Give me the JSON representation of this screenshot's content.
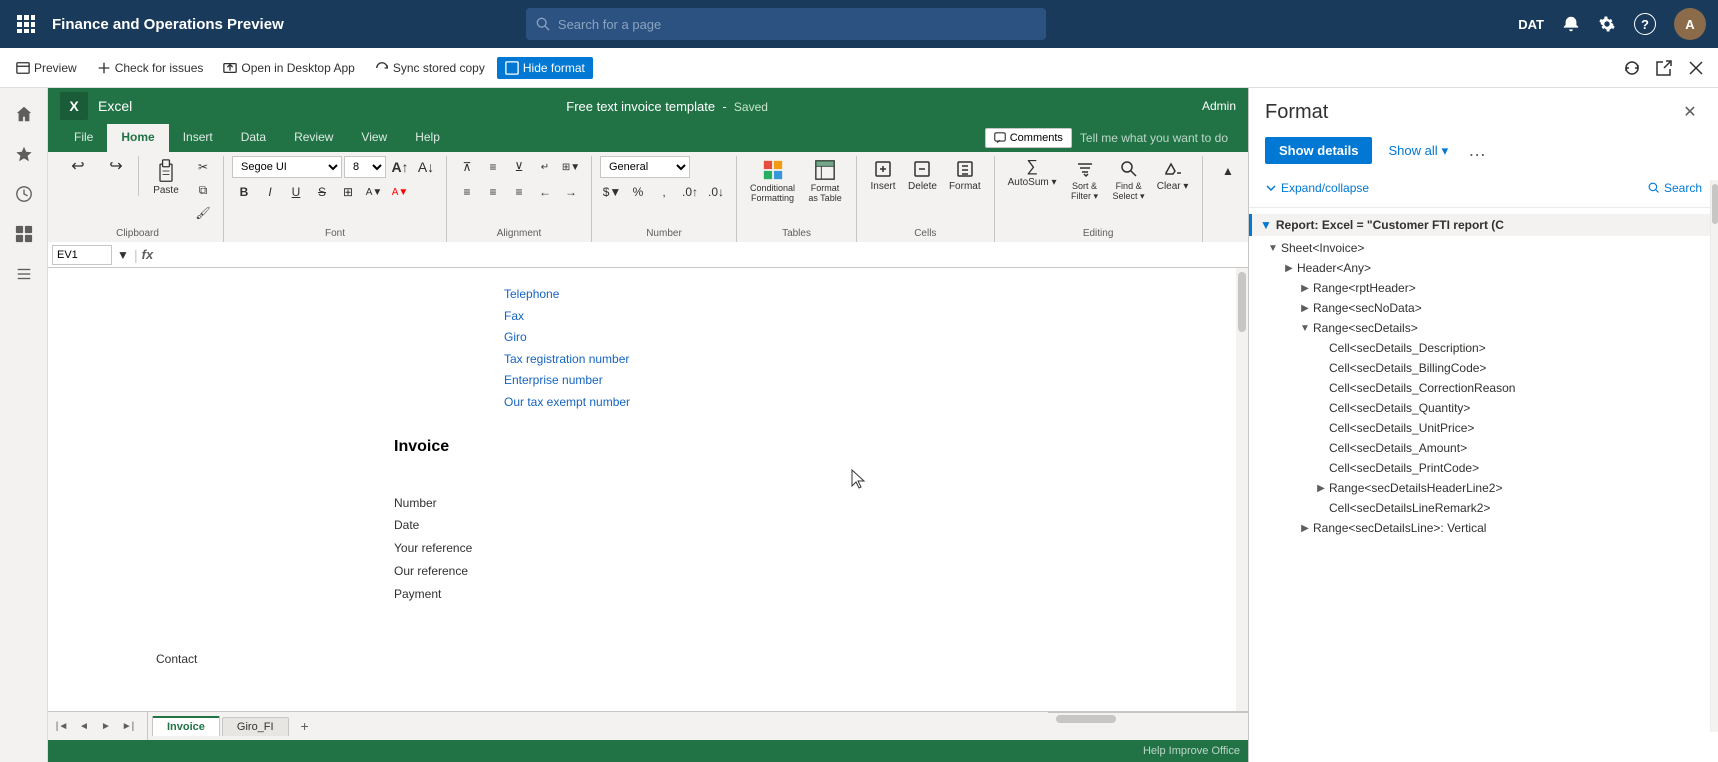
{
  "topnav": {
    "waffle_icon": "⊞",
    "title": "Finance and Operations Preview",
    "search_placeholder": "Search for a page",
    "env": "DAT",
    "bell_icon": "🔔",
    "gear_icon": "⚙",
    "help_icon": "?",
    "avatar_initials": "A"
  },
  "toolbar": {
    "preview_label": "Preview",
    "check_issues_label": "Check for issues",
    "open_desktop_label": "Open in Desktop App",
    "sync_label": "Sync stored copy",
    "hide_format_label": "Hide format"
  },
  "excel": {
    "logo_letter": "X",
    "app_name": "Excel",
    "file_title": "Free text invoice template",
    "separator": "-",
    "saved_status": "Saved",
    "admin_label": "Admin"
  },
  "ribbon": {
    "tabs": [
      "File",
      "Home",
      "Insert",
      "Data",
      "Review",
      "View",
      "Help"
    ],
    "active_tab": "Home",
    "tell_me": "Tell me what you want to do",
    "comments_label": "Comments",
    "groups": {
      "undo": {
        "label": "Undo",
        "redo": "Redo"
      },
      "paste_label": "Clipboard",
      "font_label": "Font",
      "alignment_label": "Alignment",
      "number_label": "Number",
      "tables_label": "Tables",
      "cells_label": "Cells",
      "editing_label": "Editing"
    },
    "font_name": "Segoe UI",
    "font_size": "8",
    "number_format": "General",
    "format_as_table": "Format as Table",
    "conditional": "Conditional Formatting",
    "format": "Format",
    "insert": "Insert",
    "delete": "Delete",
    "autosum": "AutoSum",
    "sort_filter": "Sort & Filter",
    "find_select": "Find & Select",
    "clear": "Clear ~"
  },
  "formula_bar": {
    "cell_ref": "EV1",
    "fx_label": "fx"
  },
  "spreadsheet": {
    "fields": [
      "Telephone",
      "Fax",
      "Giro",
      "Tax registration number",
      "Enterprise number",
      "Our tax exempt number"
    ],
    "invoice_title": "Invoice",
    "invoice_fields": [
      "Number",
      "Date",
      "Your reference",
      "Our reference",
      "Payment"
    ],
    "contact_label": "Contact"
  },
  "sheet_tabs": {
    "tabs": [
      "Invoice",
      "Giro_FI"
    ],
    "active": "Invoice"
  },
  "status_bar": {
    "help": "Help Improve Office"
  },
  "right_panel": {
    "title": "Format",
    "show_details_label": "Show details",
    "show_all_label": "Show all",
    "expand_label": "Expand/collapse",
    "search_label": "Search",
    "close_icon": "✕",
    "more_icon": "…",
    "root_item": "Report: Excel = \"Customer FTI report (C",
    "tree": [
      {
        "label": "Sheet<Invoice>",
        "indent": 1,
        "expanded": true,
        "toggle": "▼"
      },
      {
        "label": "Header<Any>",
        "indent": 2,
        "expanded": false,
        "toggle": "▶"
      },
      {
        "label": "Range<rptHeader>",
        "indent": 3,
        "expanded": false,
        "toggle": "▶"
      },
      {
        "label": "Range<secNoData>",
        "indent": 3,
        "expanded": false,
        "toggle": "▶"
      },
      {
        "label": "Range<secDetails>",
        "indent": 3,
        "expanded": true,
        "toggle": "▼"
      },
      {
        "label": "Cell<secDetails_Description>",
        "indent": 4,
        "expanded": false,
        "toggle": ""
      },
      {
        "label": "Cell<secDetails_BillingCode>",
        "indent": 4,
        "expanded": false,
        "toggle": ""
      },
      {
        "label": "Cell<secDetails_CorrectionReason",
        "indent": 4,
        "expanded": false,
        "toggle": ""
      },
      {
        "label": "Cell<secDetails_Quantity>",
        "indent": 4,
        "expanded": false,
        "toggle": ""
      },
      {
        "label": "Cell<secDetails_UnitPrice>",
        "indent": 4,
        "expanded": false,
        "toggle": ""
      },
      {
        "label": "Cell<secDetails_Amount>",
        "indent": 4,
        "expanded": false,
        "toggle": ""
      },
      {
        "label": "Cell<secDetails_PrintCode>",
        "indent": 4,
        "expanded": false,
        "toggle": ""
      },
      {
        "label": "Range<secDetailsHeaderLine2>",
        "indent": 4,
        "expanded": false,
        "toggle": "▶"
      },
      {
        "label": "Cell<secDetailsLineRemark2>",
        "indent": 4,
        "expanded": false,
        "toggle": ""
      },
      {
        "label": "Range<secDetailsLine>: Vertical",
        "indent": 3,
        "expanded": false,
        "toggle": "▶"
      }
    ]
  }
}
